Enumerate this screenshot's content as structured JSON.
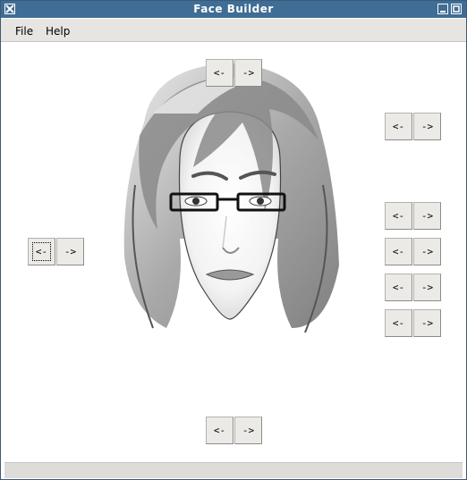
{
  "window": {
    "title": "Face Builder"
  },
  "menu": {
    "file": "File",
    "help": "Help"
  },
  "controls": {
    "prev_label": "<-",
    "next_label": "->"
  },
  "face": {
    "description_icon": "portrait-illustration"
  }
}
